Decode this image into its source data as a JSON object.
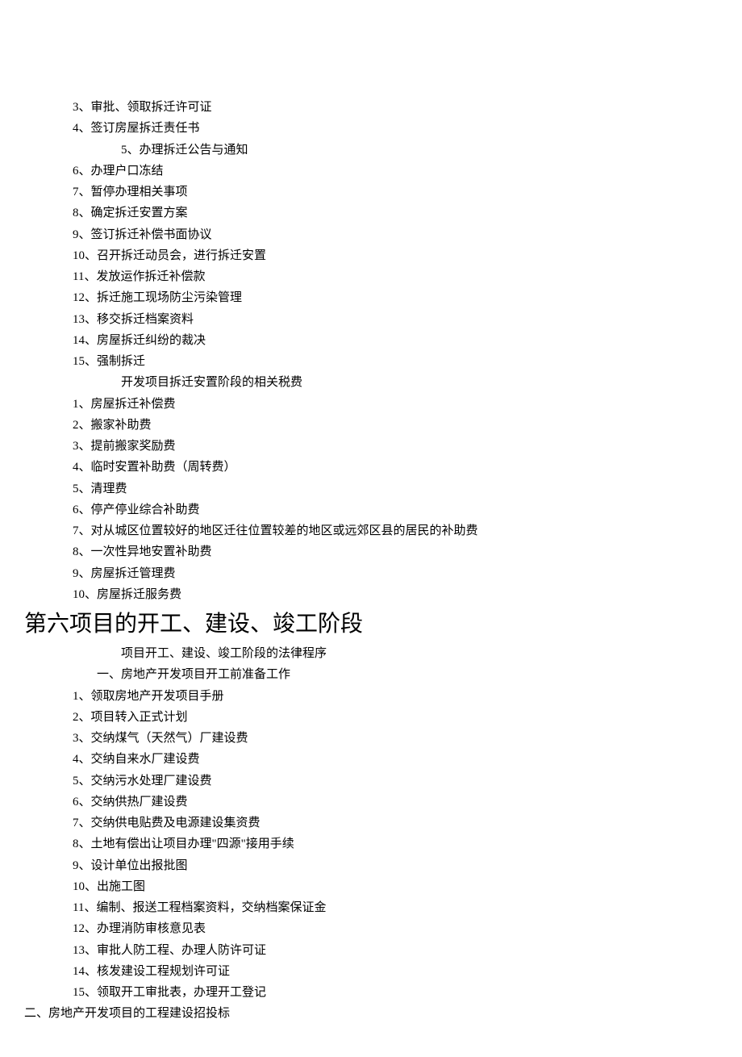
{
  "section1": {
    "items": [
      "3、审批、领取拆迁许可证",
      "4、签订房屋拆迁责任书"
    ],
    "indented": "5、办理拆迁公告与通知",
    "items2": [
      "6、办理户口冻结",
      "7、暂停办理相关事项",
      "8、确定拆迁安置方案",
      "9、签订拆迁补偿书面协议",
      "10、召开拆迁动员会，进行拆迁安置",
      "11、发放运作拆迁补偿款",
      "12、拆迁施工现场防尘污染管理",
      "13、移交拆迁档案资料",
      "14、房屋拆迁纠纷的裁决",
      "15、强制拆迁"
    ]
  },
  "section2": {
    "subtitle": "开发项目拆迁安置阶段的相关税费",
    "items": [
      "1、房屋拆迁补偿费",
      "2、搬家补助费",
      "3、提前搬家奖励费",
      "4、临时安置补助费（周转费）",
      "5、清理费",
      "6、停产停业综合补助费",
      "7、对从城区位置较好的地区迁往位置较差的地区或远郊区县的居民的补助费",
      "8、一次性异地安置补助费",
      "9、房屋拆迁管理费",
      "10、房屋拆迁服务费"
    ]
  },
  "heading": "第六项目的开工、建设、竣工阶段",
  "section3": {
    "subtitle1": "项目开工、建设、竣工阶段的法律程序",
    "subtitle2": "一、房地产开发项目开工前准备工作",
    "items": [
      "1、领取房地产开发项目手册",
      "2、项目转入正式计划",
      "3、交纳煤气（天然气）厂建设费",
      "4、交纳自来水厂建设费",
      "5、交纳污水处理厂建设费",
      "6、交纳供热厂建设费",
      "7、交纳供电贴费及电源建设集资费",
      "8、土地有偿出让项目办理\"四源\"接用手续",
      "9、设计单位出报批图",
      "10、出施工图",
      "11、编制、报送工程档案资料，交纳档案保证金",
      "12、办理消防审核意见表",
      "13、审批人防工程、办理人防许可证",
      "14、核发建设工程规划许可证",
      "15、领取开工审批表，办理开工登记"
    ]
  },
  "footer": "二、房地产开发项目的工程建设招投标"
}
